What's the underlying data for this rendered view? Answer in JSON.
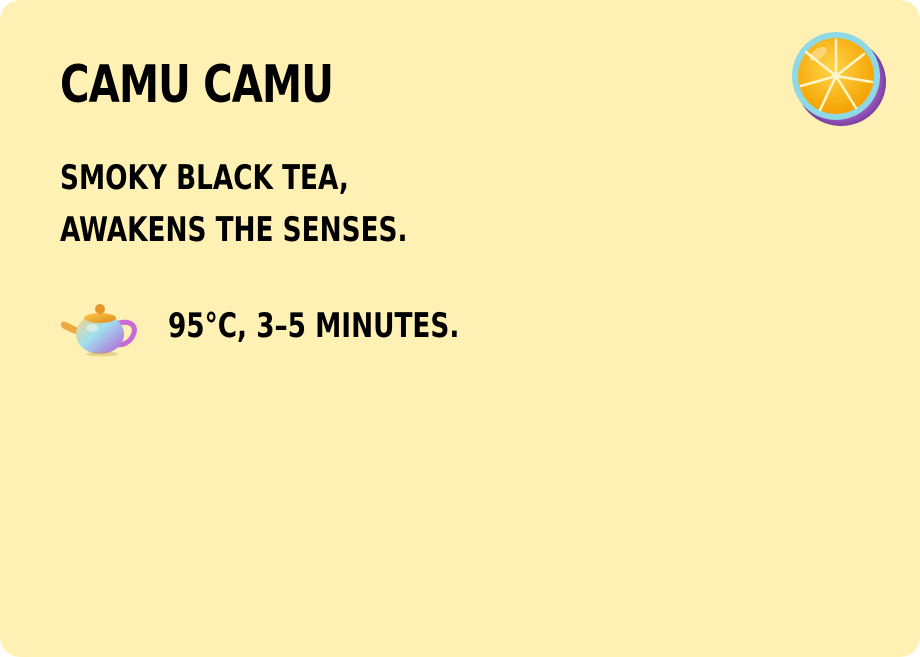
{
  "card": {
    "title": "CAMU CAMU",
    "description_line1": "SMOKY BLACK TEA,",
    "description_line2": "AWAKENS THE SENSES.",
    "brew_instructions": "95°C, 3–5 MINUTES."
  },
  "icons": {
    "fruit": "citrus-slice-icon",
    "teapot": "teapot-icon"
  },
  "colors": {
    "background": "#fff1b3",
    "text": "#000000"
  }
}
